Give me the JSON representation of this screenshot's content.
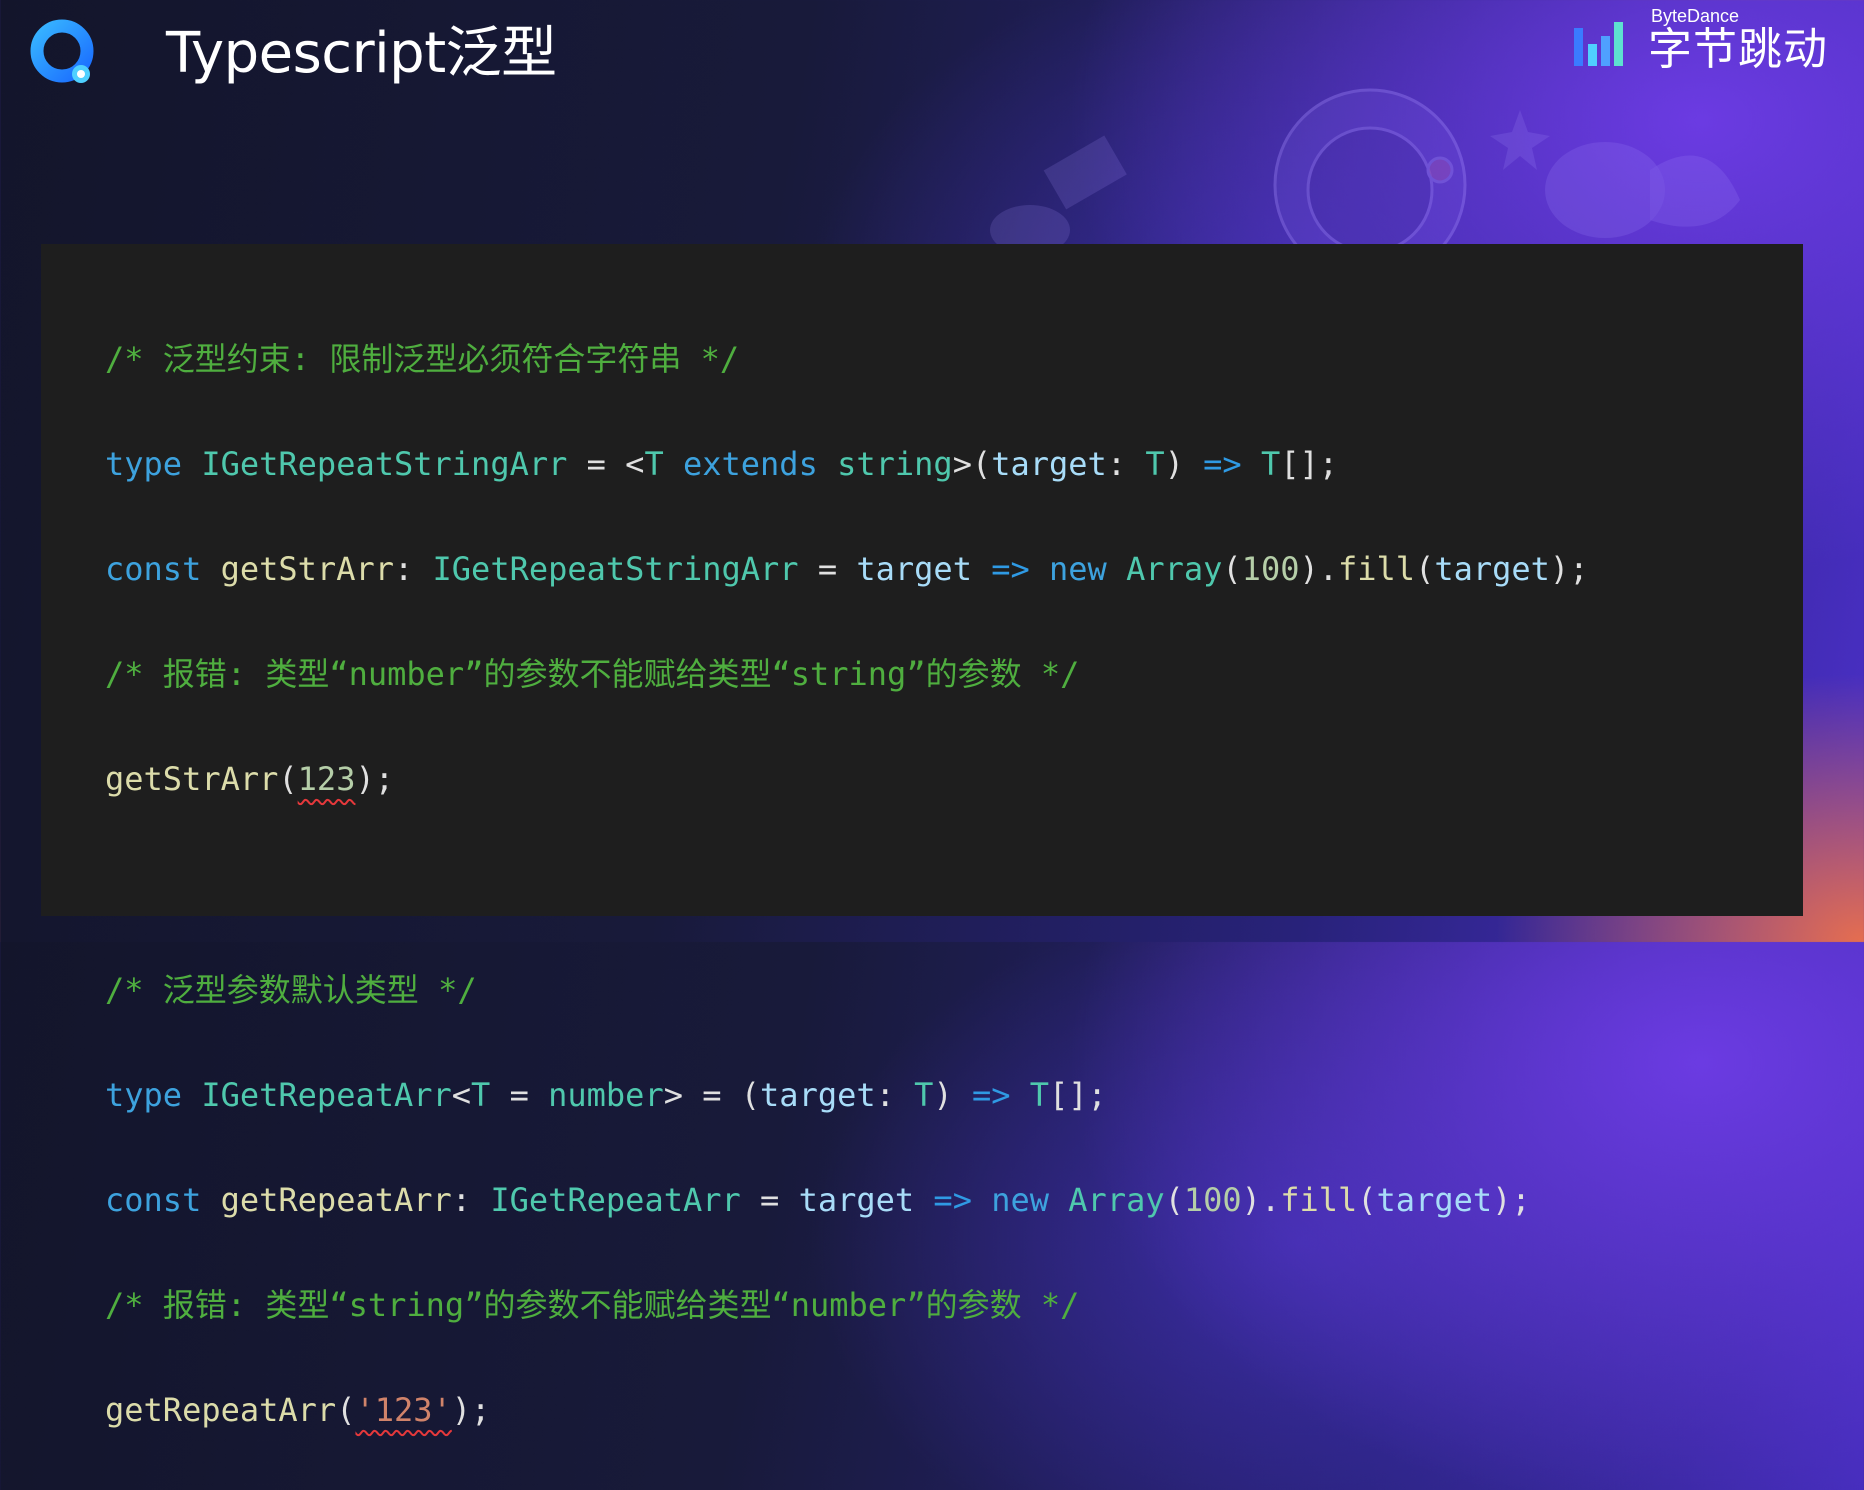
{
  "slide": {
    "title": "Typescript泛型",
    "brand_en": "ByteDance",
    "brand_cn": "字节跳动"
  },
  "code": {
    "comment1": "/* 泛型约束: 限制泛型必须符合字符串 */",
    "comment2": "/* 报错: 类型“number”的参数不能赋给类型“string”的参数 */",
    "comment3": "/* 泛型参数默认类型 */",
    "comment4": "/* 报错: 类型“string”的参数不能赋给类型“number”的参数 */",
    "kw_type": "type",
    "kw_const": "const",
    "kw_extends": "extends",
    "kw_new": "new",
    "arrow": "=>",
    "id_IGetRepeatStringArr": "IGetRepeatStringArr",
    "id_getStrArr": "getStrArr",
    "id_IGetRepeatArr": "IGetRepeatArr",
    "id_getRepeatArr": "getRepeatArr",
    "id_target": "target",
    "id_T": "T",
    "id_Array": "Array",
    "id_fill": "fill",
    "type_string": "string",
    "type_number": "number",
    "num_100": "100",
    "num_123": "123",
    "str_123": "'123'"
  },
  "colors": {
    "code_background": "#1e1e1e",
    "comment": "#4fae3f",
    "keyword": "#3da2de",
    "type": "#4fc8ad",
    "function": "#dcdcaa",
    "error_underline": "#e5383b"
  }
}
